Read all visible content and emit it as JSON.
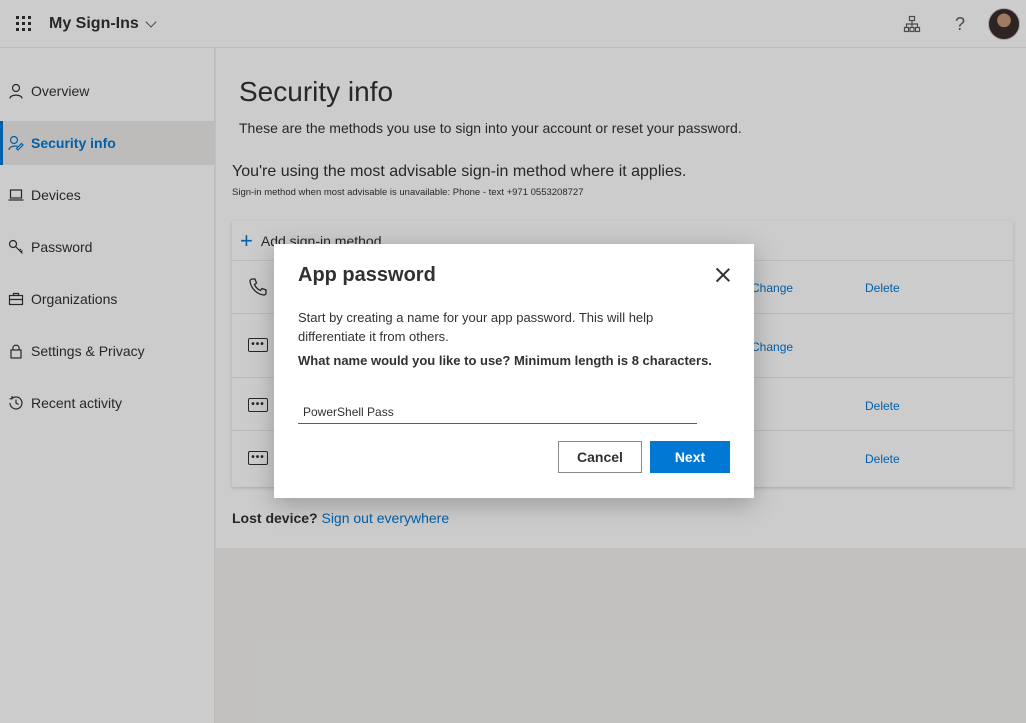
{
  "header": {
    "app_title": "My Sign-Ins",
    "help_glyph": "?"
  },
  "sidebar": {
    "items": [
      {
        "label": "Overview",
        "icon": "person-icon"
      },
      {
        "label": "Security info",
        "icon": "person-edit-icon",
        "active": true
      },
      {
        "label": "Devices",
        "icon": "laptop-icon"
      },
      {
        "label": "Password",
        "icon": "key-icon"
      },
      {
        "label": "Organizations",
        "icon": "briefcase-icon"
      },
      {
        "label": "Settings & Privacy",
        "icon": "lock-icon"
      },
      {
        "label": "Recent activity",
        "icon": "history-icon"
      }
    ]
  },
  "main": {
    "title": "Security info",
    "subtitle": "These are the methods you use to sign into your account or reset your password.",
    "advisable": "You're using the most advisable sign-in method where it applies.",
    "advisable_small": "Sign-in method when most advisable is unavailable: Phone - text +971 0553208727",
    "add_method_label": "Add sign-in method",
    "methods": [
      {
        "icon": "phone-icon",
        "change": "Change",
        "delete": "Delete"
      },
      {
        "icon": "password-icon",
        "change": "Change",
        "delete": ""
      },
      {
        "icon": "password-icon",
        "change": "",
        "delete": "Delete"
      },
      {
        "icon": "password-icon",
        "change": "",
        "delete": "Delete"
      }
    ],
    "lost_device_label": "Lost device?",
    "sign_out_link": "Sign out everywhere"
  },
  "dialog": {
    "title": "App password",
    "description": "Start by creating a name for your app password. This will help differentiate it from others.",
    "question": "What name would you like to use? Minimum length is 8 characters.",
    "input_value": "PowerShell Pass",
    "cancel_label": "Cancel",
    "next_label": "Next"
  },
  "colors": {
    "accent": "#0078d4",
    "text": "#323130",
    "page_bg": "#f3f2f1"
  }
}
